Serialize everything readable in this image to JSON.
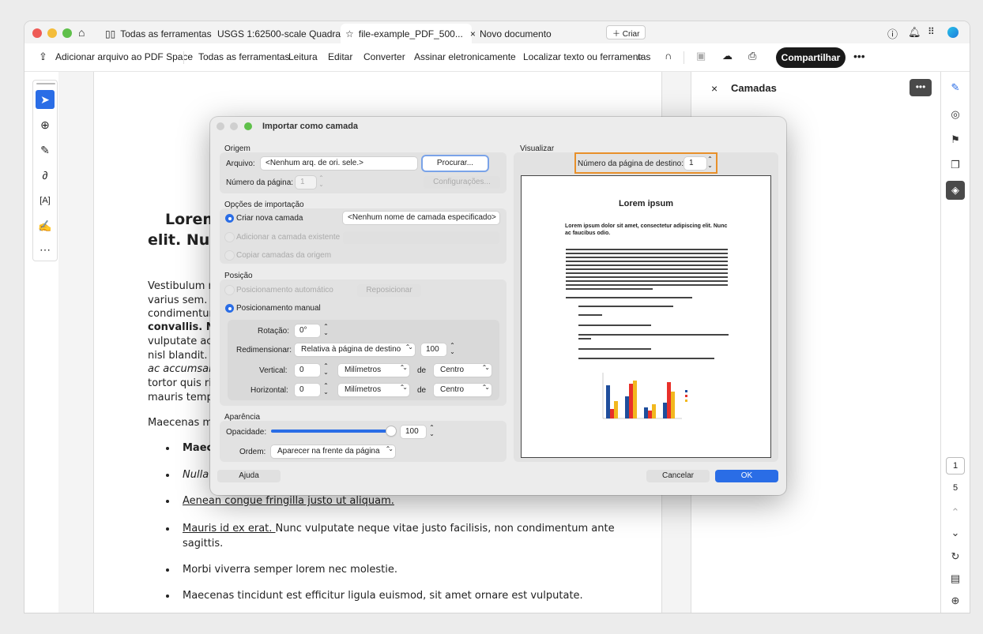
{
  "tabs": [
    {
      "label": "Todas as ferramentas"
    },
    {
      "label": "USGS 1:62500-scale Quadrangl..."
    },
    {
      "label": "file-example_PDF_500..."
    },
    {
      "label": "Novo documento"
    }
  ],
  "create_label": "Criar",
  "toolbar": {
    "add_file": "Adicionar arquivo ao PDF Space",
    "all_tools": "Todas as ferramentas",
    "read": "Leitura",
    "edit": "Editar",
    "convert": "Converter",
    "sign": "Assinar eletronicamente",
    "find": "Localizar texto ou ferramentas",
    "share": "Compartilhar"
  },
  "panel": {
    "title": "Camadas"
  },
  "page_nav": {
    "current": "1",
    "total": "5"
  },
  "document": {
    "heading_l1": "Lorem",
    "heading_l2": "elit. Nun",
    "para_lines": [
      "Vestibulum n",
      "varius  sem.",
      "condimentur",
      "convallis. N",
      "vulputate ac",
      "nisl blandit.",
      "ac accumsan",
      "tortor quis ri",
      "mauris temp"
    ],
    "para2": "Maecenas m",
    "bullets": [
      "Maec",
      "Nulla",
      "Aenean congue fringilla justo ut aliquam. ",
      "Mauris id ex erat. ",
      "Nunc vulputate neque vitae justo facilisis, non condimentum ante",
      "sagittis.",
      "Morbi viverra semper lorem nec molestie.",
      "Maecenas tincidunt est efficitur ligula euismod, sit amet ornare est vulputate."
    ]
  },
  "dialog": {
    "title": "Importar como camada",
    "origin": {
      "section": "Origem",
      "file_label": "Arquivo:",
      "file_value": "<Nenhum arq. de ori. sele.>",
      "browse": "Procurar...",
      "page_label": "Número da página:",
      "page_value": "1",
      "settings": "Configurações..."
    },
    "import_options": {
      "section": "Opções de importação",
      "new_layer": "Criar nova camada",
      "layer_name": "<Nenhum nome de camada especificado>",
      "add_existing": "Adicionar a camada existente",
      "copy_layers": "Copiar camadas da origem"
    },
    "position": {
      "section": "Posição",
      "auto": "Posicionamento automático",
      "reposition": "Reposicionar",
      "manual": "Posicionamento manual",
      "rotation_label": "Rotação:",
      "rotation_value": "0°",
      "resize_label": "Redimensionar:",
      "resize_value": "Relativa à página de destino",
      "resize_pct": "100",
      "vertical_label": "Vertical:",
      "vertical_value": "0",
      "vertical_unit": "Milímetros",
      "of1": "de",
      "vertical_ref": "Centro",
      "horizontal_label": "Horizontal:",
      "horizontal_value": "0",
      "horizontal_unit": "Milímetros",
      "of2": "de",
      "horizontal_ref": "Centro"
    },
    "appearance": {
      "section": "Aparência",
      "opacity_label": "Opacidade:",
      "opacity_value": "100",
      "opacity_fraction": 1.0,
      "order_label": "Ordem:",
      "order_value": "Aparecer na frente da página"
    },
    "preview": {
      "section": "Visualizar",
      "dest_page_label": "Número da página de destino:",
      "dest_page_value": "1",
      "page_title": "Lorem ipsum",
      "page_heading": "Lorem ipsum dolor sit amet, consectetur adipiscing elit. Nunc ac faucibus odio."
    },
    "help": "Ajuda",
    "cancel": "Cancelar",
    "ok": "OK"
  },
  "colors": {
    "accent": "#2a6de6",
    "highlight": "#e8902a",
    "share": "#1a1a1a"
  }
}
